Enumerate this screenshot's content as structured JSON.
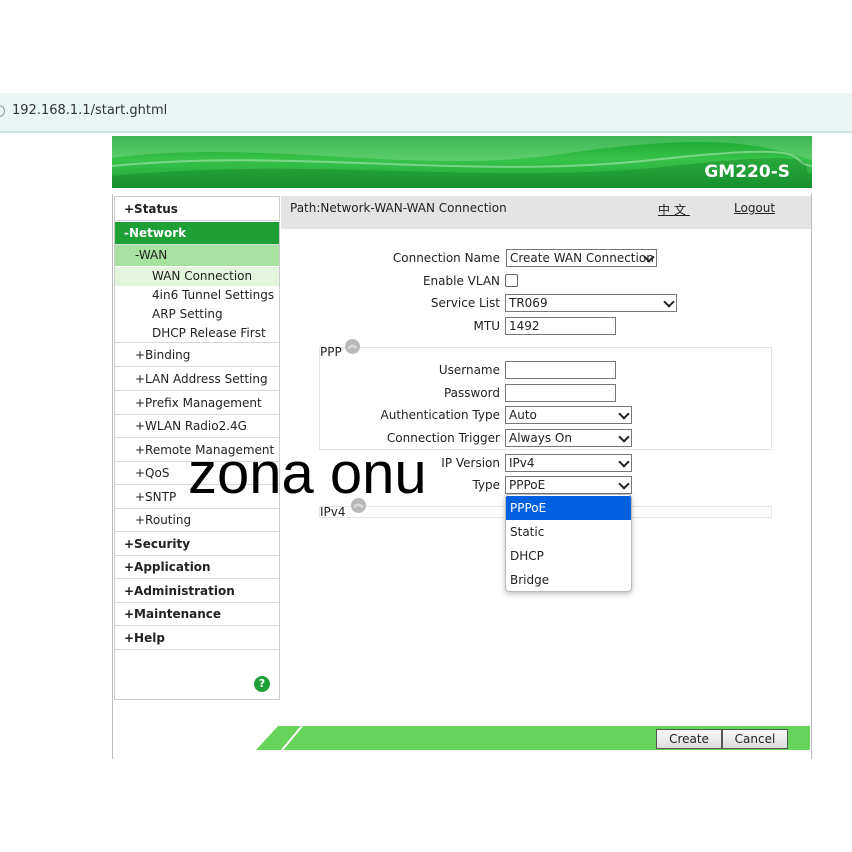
{
  "browser": {
    "url": "192.168.1.1/start.ghtml"
  },
  "banner": {
    "model": "GM220-S",
    "color": "#1fa035"
  },
  "sidebar": {
    "items": [
      {
        "label": "+Status"
      },
      {
        "label": "-Network"
      },
      {
        "label": "-WAN"
      },
      {
        "label": "WAN Connection"
      },
      {
        "label": "4in6 Tunnel Settings"
      },
      {
        "label": "ARP Setting"
      },
      {
        "label": "DHCP Release First"
      },
      {
        "label": "+Binding"
      },
      {
        "label": "+LAN Address Setting"
      },
      {
        "label": "+Prefix Management"
      },
      {
        "label": "+WLAN Radio2.4G"
      },
      {
        "label": "+Remote Management"
      },
      {
        "label": "+QoS"
      },
      {
        "label": "+SNTP"
      },
      {
        "label": "+Routing"
      },
      {
        "label": "+Security"
      },
      {
        "label": "+Application"
      },
      {
        "label": "+Administration"
      },
      {
        "label": "+Maintenance"
      },
      {
        "label": "+Help"
      }
    ],
    "help_icon": "question-icon"
  },
  "header": {
    "path": "Path:Network-WAN-WAN Connection",
    "language": "中文",
    "logout": "Logout"
  },
  "form": {
    "connection_name": {
      "label": "Connection Name",
      "value": "Create WAN Connection"
    },
    "enable_vlan": {
      "label": "Enable VLAN",
      "checked": false
    },
    "service_list": {
      "label": "Service List",
      "value": "TR069"
    },
    "mtu": {
      "label": "MTU",
      "value": "1492"
    },
    "ppp": {
      "title": "PPP",
      "username": {
        "label": "Username",
        "value": ""
      },
      "password": {
        "label": "Password",
        "value": ""
      },
      "auth_type": {
        "label": "Authentication Type",
        "value": "Auto"
      },
      "conn_trigger": {
        "label": "Connection Trigger",
        "value": "Always On"
      }
    },
    "ip_version": {
      "label": "IP Version",
      "value": "IPv4"
    },
    "type": {
      "label": "Type",
      "value": "PPPoE",
      "options": [
        "PPPoE",
        "Static",
        "DHCP",
        "Bridge"
      ]
    },
    "ipv4_title": "IPv4"
  },
  "watermark": "zona onu",
  "footer": {
    "create": "Create",
    "cancel": "Cancel"
  }
}
